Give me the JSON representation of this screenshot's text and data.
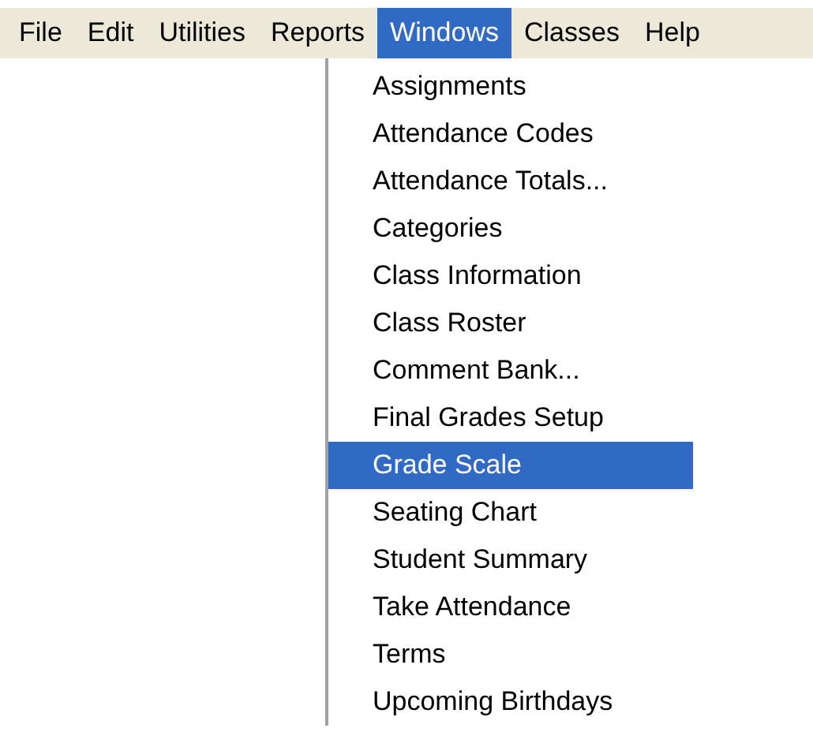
{
  "menu_bar": [
    {
      "label": "File",
      "selected": false
    },
    {
      "label": "Edit",
      "selected": false
    },
    {
      "label": "Utilities",
      "selected": false
    },
    {
      "label": "Reports",
      "selected": false
    },
    {
      "label": "Windows",
      "selected": true
    },
    {
      "label": "Classes",
      "selected": false
    },
    {
      "label": "Help",
      "selected": false
    }
  ],
  "dropdown": {
    "items": [
      {
        "label": "Assignments",
        "selected": false
      },
      {
        "label": "Attendance Codes",
        "selected": false
      },
      {
        "label": "Attendance Totals...",
        "selected": false
      },
      {
        "label": "Categories",
        "selected": false
      },
      {
        "label": "Class Information",
        "selected": false
      },
      {
        "label": "Class Roster",
        "selected": false
      },
      {
        "label": "Comment Bank...",
        "selected": false
      },
      {
        "label": "Final Grades Setup",
        "selected": false
      },
      {
        "label": "Grade Scale",
        "selected": true
      },
      {
        "label": "Seating Chart",
        "selected": false
      },
      {
        "label": "Student Summary",
        "selected": false
      },
      {
        "label": "Take Attendance",
        "selected": false
      },
      {
        "label": "Terms",
        "selected": false
      },
      {
        "label": "Upcoming Birthdays",
        "selected": false
      }
    ]
  }
}
